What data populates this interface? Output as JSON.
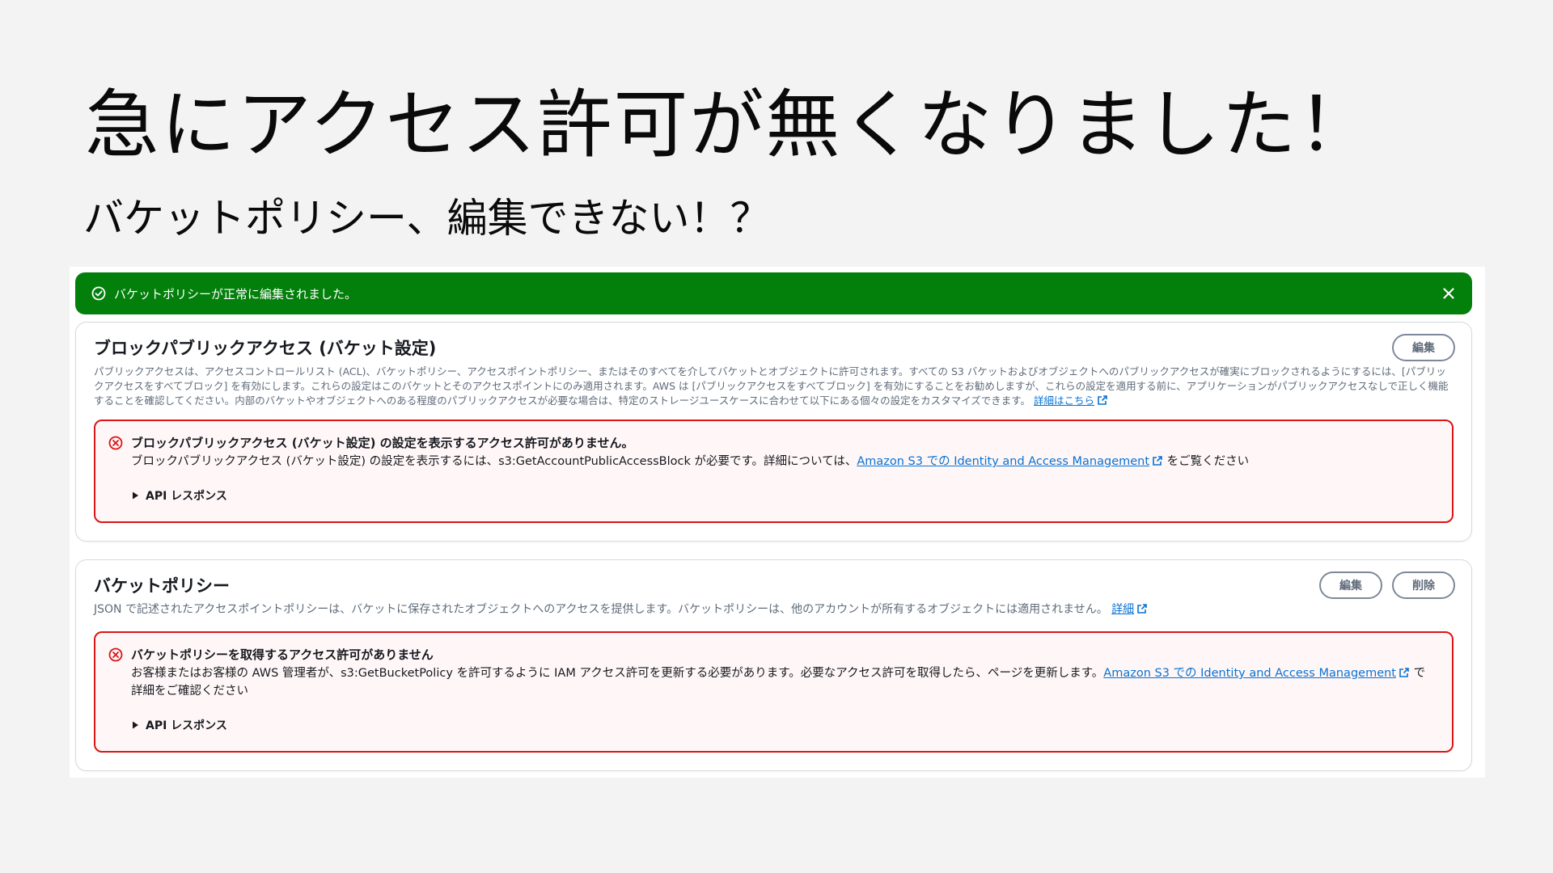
{
  "slide": {
    "title": "急にアクセス許可が無くなりました！",
    "subtitle": "バケットポリシー、編集できない！？"
  },
  "flash": {
    "message": "バケットポリシーが正常に編集されました。",
    "color": "#037f0c",
    "icon": "check-circle-icon",
    "close_icon": "close-icon"
  },
  "block_public_access": {
    "title": "ブロックパブリックアクセス (バケット設定)",
    "edit_label": "編集",
    "description": "パブリックアクセスは、アクセスコントロールリスト (ACL)、バケットポリシー、アクセスポイントポリシー、またはそのすべてを介してバケットとオブジェクトに許可されます。すべての S3 バケットおよびオブジェクトへのパブリックアクセスが確実にブロックされるようにするには、[パブリックアクセスをすべてブロック] を有効にします。これらの設定はこのバケットとそのアクセスポイントにのみ適用されます。AWS は [パブリックアクセスをすべてブロック] を有効にすることをお勧めしますが、これらの設定を適用する前に、アプリケーションがパブリックアクセスなしで正しく機能することを確認してください。内部のバケットやオブジェクトへのある程度のパブリックアクセスが必要な場合は、特定のストレージユースケースに合わせて以下にある個々の設定をカスタマイズできます。",
    "learn_more": "詳細はこちら",
    "alert": {
      "title": "ブロックパブリックアクセス (バケット設定) の設定を表示するアクセス許可がありません。",
      "body_prefix": "ブロックパブリックアクセス (バケット設定) の設定を表示するには、s3:GetAccountPublicAccessBlock が必要です。詳細については、",
      "link": "Amazon S3 での Identity and Access Management",
      "body_suffix": "をご覧ください",
      "api_toggle": "API レスポンス"
    }
  },
  "bucket_policy": {
    "title": "バケットポリシー",
    "edit_label": "編集",
    "delete_label": "削除",
    "description": "JSON で記述されたアクセスポイントポリシーは、バケットに保存されたオブジェクトへのアクセスを提供します。バケットポリシーは、他のアカウントが所有するオブジェクトには適用されません。",
    "learn_more": "詳細",
    "alert": {
      "title": "バケットポリシーを取得するアクセス許可がありません",
      "body_prefix": "お客様またはお客様の AWS 管理者が、s3:GetBucketPolicy を許可するように IAM アクセス許可を更新する必要があります。必要なアクセス許可を取得したら、ページを更新します。",
      "link": "Amazon S3 での Identity and Access Management",
      "body_suffix": "で詳細をご確認ください",
      "api_toggle": "API レスポンス"
    }
  },
  "colors": {
    "success": "#037f0c",
    "error": "#d91515",
    "link": "#0972d3"
  }
}
